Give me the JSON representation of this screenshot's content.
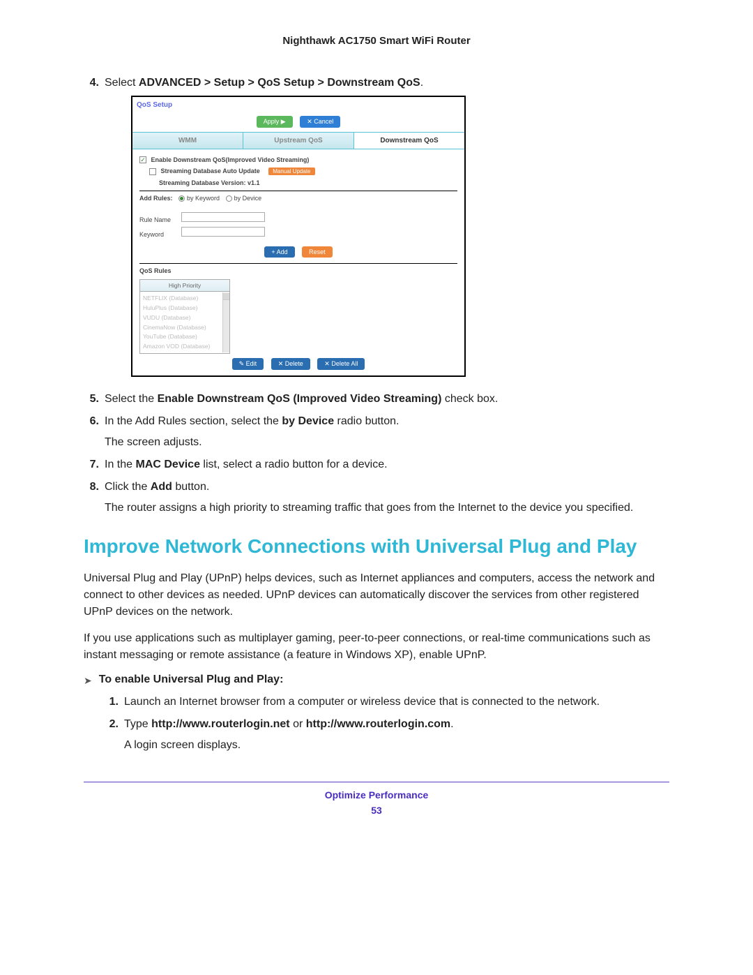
{
  "header": {
    "title": "Nighthawk AC1750 Smart WiFi Router"
  },
  "steps": {
    "s4_num": "4.",
    "s4_pre": "Select ",
    "s4_bold": "ADVANCED > Setup > QoS Setup > Downstream QoS",
    "s4_post": ".",
    "s5_num": "5.",
    "s5_pre": "Select the ",
    "s5_bold": "Enable Downstream QoS (Improved Video Streaming)",
    "s5_post": " check box.",
    "s6_num": "6.",
    "s6_pre": "In the Add Rules section, select the ",
    "s6_bold": "by Device",
    "s6_post": " radio button.",
    "s6_p2": "The screen adjusts.",
    "s7_num": "7.",
    "s7_pre": "In the ",
    "s7_bold": "MAC Device",
    "s7_post": " list, select a radio button for a device.",
    "s8_num": "8.",
    "s8_pre": "Click the ",
    "s8_bold": "Add",
    "s8_post": " button.",
    "s8_p2": "The router assigns a high priority to streaming traffic that goes from the Internet to the device you specified."
  },
  "screenshot": {
    "title": "QoS Setup",
    "apply": "Apply ▶",
    "cancel": "✕ Cancel",
    "tab_wmm": "WMM",
    "tab_upstream": "Upstream QoS",
    "tab_downstream": "Downstream QoS",
    "chk_enable": "Enable Downstream QoS(Improved Video Streaming)",
    "chk_auto": "Streaming Database Auto Update",
    "manual_update": "Manual Update",
    "version": "Streaming Database Version: v1.1",
    "add_rules_label": "Add Rules:",
    "by_keyword": "by Keyword",
    "by_device": "by Device",
    "rule_name": "Rule Name",
    "keyword": "Keyword",
    "add_btn": "+ Add",
    "reset_btn": "Reset",
    "qos_rules_label": "QoS Rules",
    "high_priority": "High Priority",
    "rules": [
      "NETFLIX (Database)",
      "HuluPlus (Database)",
      "VUDU (Database)",
      "CinemaNow (Database)",
      "YouTube (Database)",
      "Amazon VOD (Database)"
    ],
    "edit": "✎ Edit",
    "delete": "✕ Delete",
    "delete_all": "✕ Delete All"
  },
  "section": {
    "heading": "Improve Network Connections with Universal Plug and Play",
    "p1": "Universal Plug and Play (UPnP) helps devices, such as Internet appliances and computers, access the network and connect to other devices as needed. UPnP devices can automatically discover the services from other registered UPnP devices on the network.",
    "p2": "If you use applications such as multiplayer gaming, peer-to-peer connections, or real-time communications such as instant messaging or remote assistance (a feature in Windows XP), enable UPnP.",
    "task_arrow": "➤",
    "task": "To enable Universal Plug and Play:",
    "t1_num": "1.",
    "t1": "Launch an Internet browser from a computer or wireless device that is connected to the network.",
    "t2_num": "2.",
    "t2_pre": "Type ",
    "t2_b1": "http://www.routerlogin.net",
    "t2_mid": " or ",
    "t2_b2": "http://www.routerlogin.com",
    "t2_post": ".",
    "t2_p2": "A login screen displays."
  },
  "footer": {
    "section": "Optimize Performance",
    "page": "53"
  }
}
